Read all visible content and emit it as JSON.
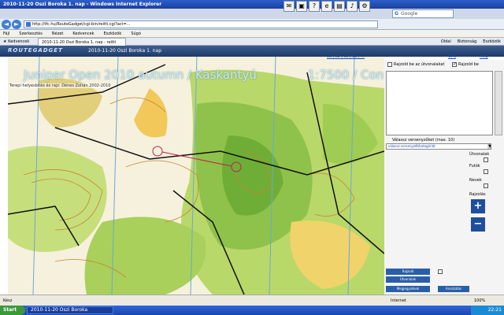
{
  "window": {
    "title": "2010-11-20 Oszi Boroka 1. nap - Windows Internet Explorer"
  },
  "browser": {
    "address": "http://tfc.hu/RouteGadget/cgi-bin/reitti.cgi?act=...",
    "search_engine": "Google",
    "menu": [
      "Fájl",
      "Szerkesztés",
      "Nézet",
      "Kedvencek",
      "Eszközök",
      "Súgó"
    ],
    "favorites_label": "Kedvencek",
    "tab_label": "2010-11-20 Oszi Boroka 1. nap - reitti",
    "command_bar": [
      "Oldal",
      "Biztonság",
      "Eszközök"
    ]
  },
  "app": {
    "logo": "ROUTEGADGET",
    "event_title": "2010-11-20 Oszi Boroka 1. nap"
  },
  "map": {
    "title": "Juniper Open 2010 autumn / Kaskantyú",
    "scale": "1:7500 / Con",
    "credit": "Terepi helyesbítés és rajz: Dénes Zoltán 2002-2010",
    "links": "ca | cb | ca | da | ..."
  },
  "side": {
    "gps_link": "GPS",
    "help_link": "help",
    "checkbox_1": "Rajzold be az útvonalakat",
    "checkbox_2": "Rajzold be",
    "runners_label": "Válassz versenyzőket (max. 10)",
    "class_select": "válassz versenyzőt/kategóriát",
    "options": [
      "Útvonalak",
      "Futók",
      "Nevek",
      "Rajzolás"
    ],
    "zoom_in": "+",
    "zoom_out": "−",
    "buttons": [
      "Rajzold",
      "Útvonalak",
      "Megjegyzések",
      "Analizálás"
    ]
  },
  "status": {
    "text": "Kész",
    "zone": "Internet",
    "zoom": "100%"
  },
  "taskbar": {
    "start": "Start",
    "item": "2010-11-20 Oszi Boroka",
    "clock": "22:21"
  }
}
